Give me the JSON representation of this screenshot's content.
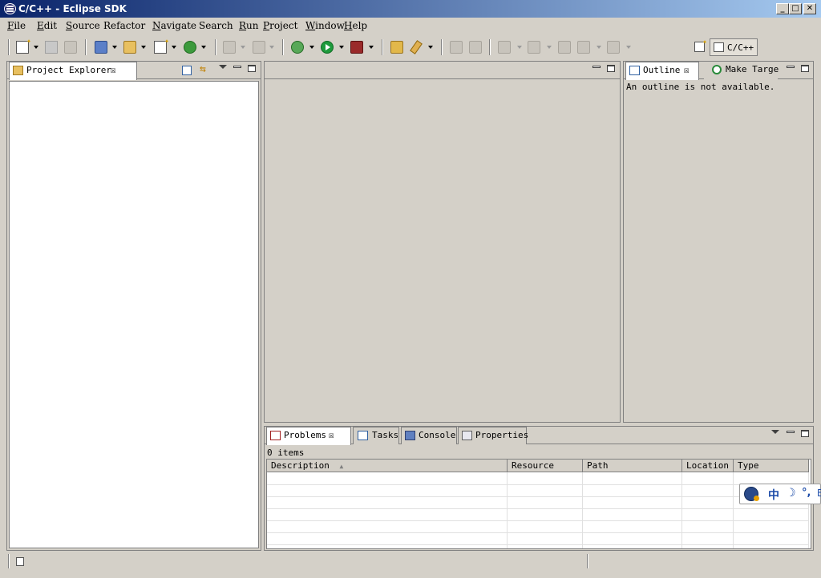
{
  "window": {
    "title": "C/C++ - Eclipse SDK",
    "minimize": "_",
    "maximize": "□",
    "close": "✕"
  },
  "menubar": {
    "items": [
      {
        "first": "F",
        "rest": "ile"
      },
      {
        "first": "E",
        "rest": "dit"
      },
      {
        "first": "S",
        "rest": "ource"
      },
      {
        "first": "",
        "rest": "Refactor"
      },
      {
        "first": "N",
        "rest": "avigate"
      },
      {
        "first": "",
        "rest": "Search"
      },
      {
        "first": "R",
        "rest": "un"
      },
      {
        "first": "P",
        "rest": "roject"
      },
      {
        "first": "W",
        "rest": "indow"
      },
      {
        "first": "H",
        "rest": "elp"
      }
    ]
  },
  "perspective": {
    "label": "C/C++"
  },
  "project_explorer": {
    "tab_label": "Project Explorer",
    "close": "☒"
  },
  "outline": {
    "tabs": [
      {
        "label": "Outline",
        "close": "☒"
      },
      {
        "label": "Make Targe"
      }
    ],
    "message": "An outline is not available."
  },
  "bottom_panel": {
    "tabs": [
      {
        "label": "Problems",
        "close": "☒"
      },
      {
        "label": "Tasks"
      },
      {
        "label": "Console"
      },
      {
        "label": "Properties"
      }
    ],
    "item_count": "0 items",
    "columns": [
      "Description",
      "Resource",
      "Path",
      "Location",
      "Type"
    ],
    "sort_indicator": "▲"
  },
  "ime": {
    "lang": "中",
    "moon": "☽",
    "dot": "°,",
    "extra": "E"
  },
  "colors": {
    "title_start": "#0a246a",
    "title_end": "#a6caf0",
    "chrome": "#d4d0c8"
  }
}
